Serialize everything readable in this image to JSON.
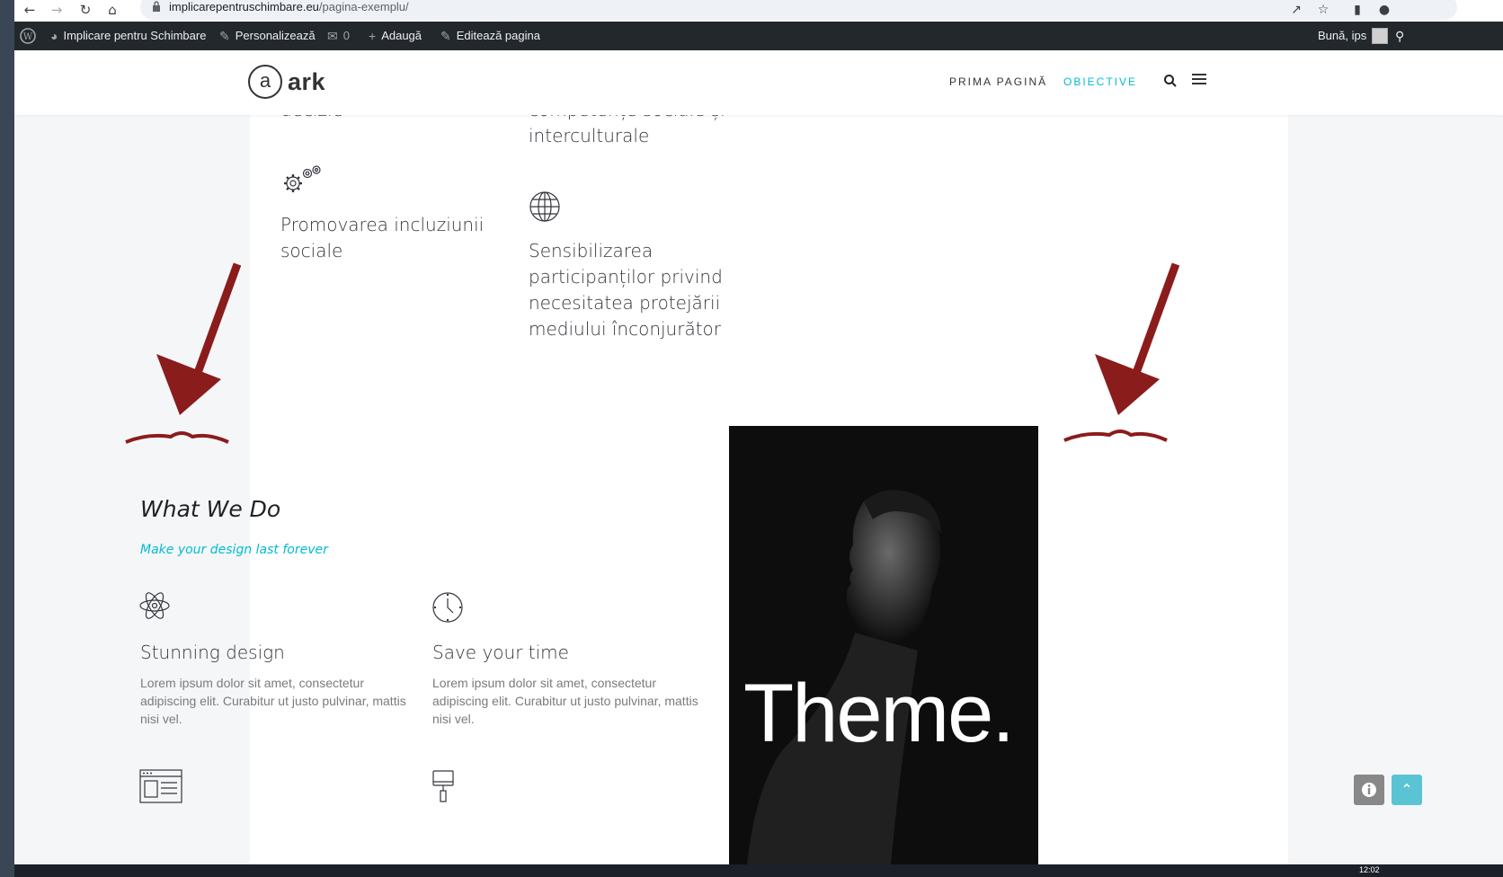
{
  "browser": {
    "url_domain": "implicarepentruschimbare.eu",
    "url_path": "/pagina-exemplu/"
  },
  "adminbar": {
    "site_name": "Implicare pentru Schimbare",
    "customize": "Personalizează",
    "comments_count": "0",
    "add_new": "Adaugă",
    "edit_page": "Editează pagina",
    "greeting": "Bună, ips"
  },
  "header": {
    "logo_letter": "a",
    "logo_word": "ark",
    "nav": [
      "PRIMA PAGINĂ",
      "OBIECTIVE"
    ],
    "active_nav": "OBIECTIVE",
    "accent_color": "#00bcd4"
  },
  "features_top": {
    "top_left_fragment": "decizie",
    "top_right_fragment_1": "competențe sociale și",
    "top_right_fragment_2": "interculturale",
    "left_item": {
      "icon": "gears-icon",
      "line1": "Promovarea incluziunii",
      "line2": "sociale"
    },
    "right_item": {
      "icon": "globe-icon",
      "lines": [
        "Sensibilizarea",
        "participanților privind",
        "necesitatea protejării",
        "mediului înconjurător"
      ]
    }
  },
  "annotation_color": "#8b1c1c",
  "what_we_do": {
    "heading": "What We Do",
    "subheading": "Make your design last forever",
    "items": [
      {
        "icon": "atom-icon",
        "title": "Stunning design",
        "text": "Lorem ipsum dolor sit amet, consectetur adipiscing elit. Curabitur ut justo pulvinar, mattis nisi vel."
      },
      {
        "icon": "clock-icon",
        "title": "Save your time",
        "text": "Lorem ipsum dolor sit amet, consectetur adipiscing elit. Curabitur ut justo pulvinar, mattis nisi vel."
      }
    ],
    "more_icons": [
      "browser-window-icon",
      "paint-roller-icon"
    ]
  },
  "photo": {
    "caption": "Theme."
  },
  "taskbar": {
    "clock": "12:02"
  }
}
